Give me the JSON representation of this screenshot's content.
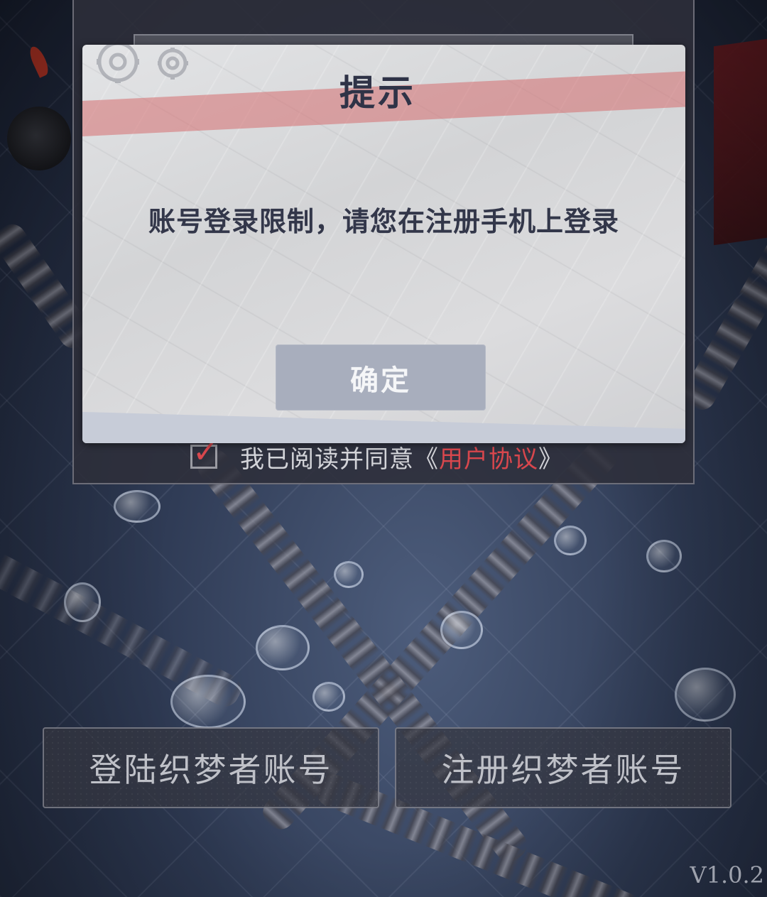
{
  "dialog": {
    "title": "提示",
    "message": "账号登录限制，请您在注册手机上登录",
    "confirm_label": "确定"
  },
  "agreement": {
    "text": "我已阅读并同意",
    "open_bracket": "《",
    "link": "用户协议",
    "close_bracket": "》",
    "checked": true
  },
  "buttons": {
    "login": "登陆织梦者账号",
    "register": "注册织梦者账号"
  },
  "version": "V1.0.2",
  "colors": {
    "accent": "#d8474d",
    "dialog_text": "#2f3347",
    "confirm_bg": "#a8aebd"
  },
  "icons": [
    "gear-icon",
    "checkmark-icon"
  ]
}
